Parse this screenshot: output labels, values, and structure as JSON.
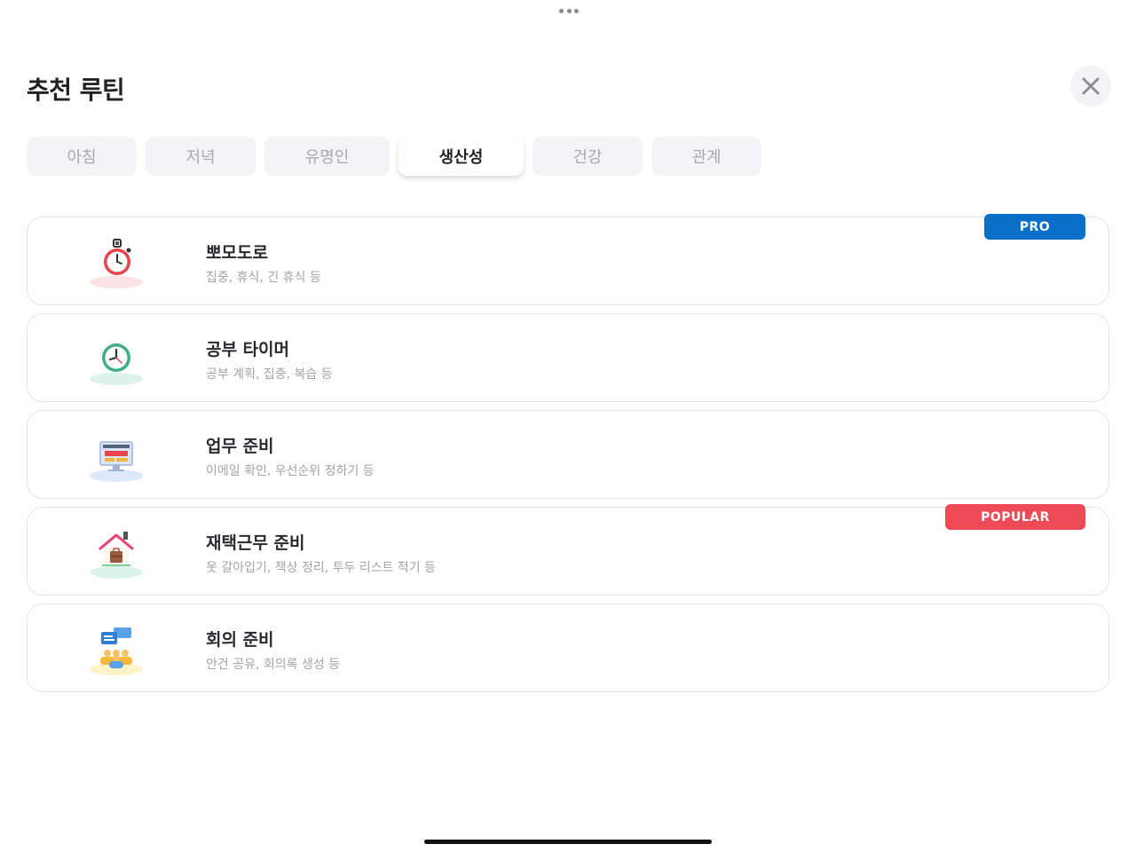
{
  "header": {
    "title": "추천 루틴",
    "close_icon": "close-icon"
  },
  "tabs": [
    {
      "label": "아침",
      "active": false
    },
    {
      "label": "저녁",
      "active": false
    },
    {
      "label": "유명인",
      "active": false
    },
    {
      "label": "생산성",
      "active": true
    },
    {
      "label": "건강",
      "active": false
    },
    {
      "label": "관계",
      "active": false
    }
  ],
  "routines": [
    {
      "name": "뽀모도로",
      "desc": "집중, 휴식, 긴 휴식 등",
      "icon": "stopwatch-icon",
      "badge": "PRO",
      "badge_color": "#0a6fc9"
    },
    {
      "name": "공부 타이머",
      "desc": "공부 계획, 집중, 복습 등",
      "icon": "clock-icon"
    },
    {
      "name": "업무 준비",
      "desc": "이메일 확인, 우선순위 정하기 등",
      "icon": "computer-icon"
    },
    {
      "name": "재택근무 준비",
      "desc": "옷 갈아입기, 책상 정리, 투두 리스트 적기 등",
      "icon": "house-icon",
      "badge": "POPULAR",
      "badge_color": "#ef4a58"
    },
    {
      "name": "회의 준비",
      "desc": "안건 공유, 회의록 생성 등",
      "icon": "meeting-icon"
    }
  ],
  "colors": {
    "pro": "#0a6fc9",
    "popular": "#ef4a58"
  }
}
